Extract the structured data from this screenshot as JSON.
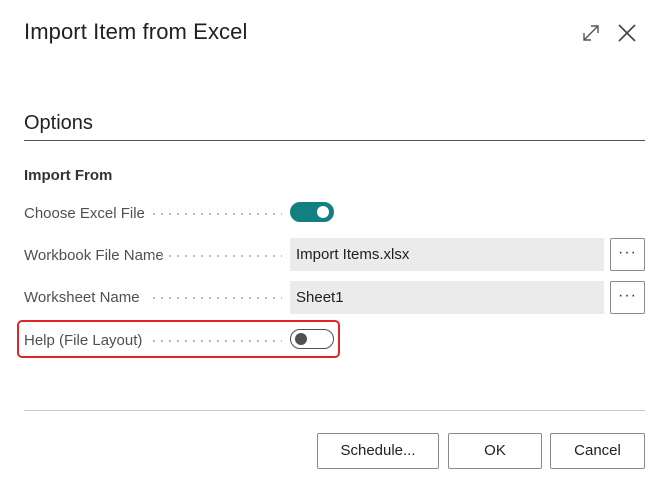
{
  "dialog": {
    "title": "Import Item from Excel",
    "icons": {
      "expand": "expand-icon",
      "close": "close-icon"
    }
  },
  "options": {
    "section_title": "Options",
    "group_title": "Import From",
    "fields": {
      "choose_excel_file": {
        "label": "Choose Excel File",
        "value": true
      },
      "workbook_file_name": {
        "label": "Workbook File Name",
        "value": "Import Items.xlsx",
        "lookup_label": "···"
      },
      "worksheet_name": {
        "label": "Worksheet Name",
        "value": "Sheet1",
        "lookup_label": "···"
      },
      "help_file_layout": {
        "label": "Help (File Layout)",
        "value": false
      }
    }
  },
  "footer": {
    "schedule_label": "Schedule...",
    "ok_label": "OK",
    "cancel_label": "Cancel"
  },
  "colors": {
    "accent": "#128080",
    "highlight": "#e0242c",
    "field_background": "#ebebeb"
  }
}
